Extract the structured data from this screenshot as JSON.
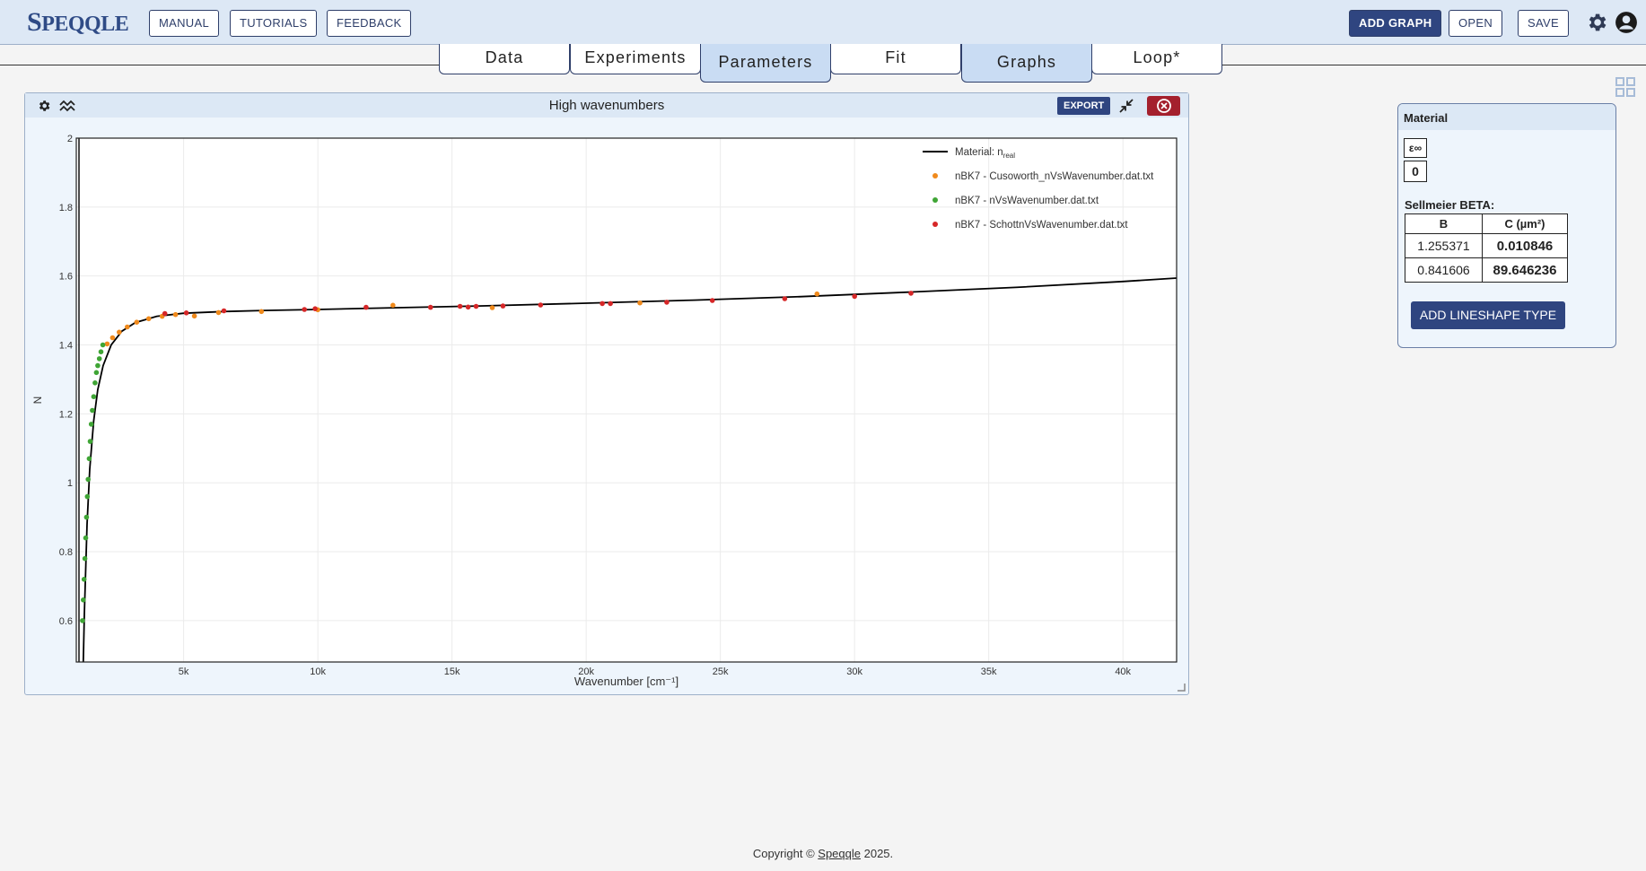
{
  "app": {
    "logo": "Speqqle",
    "logo_first": "S",
    "logo_rest": "PEQQLE"
  },
  "topbar": {
    "manual": "MANUAL",
    "tutorials": "TUTORIALS",
    "feedback": "FEEDBACK",
    "add_graph": "ADD GRAPH",
    "open": "OPEN",
    "save": "SAVE"
  },
  "tabs": [
    {
      "label": "Data"
    },
    {
      "label": "Experiments"
    },
    {
      "label": "Parameters",
      "active": true
    },
    {
      "label": "Fit"
    },
    {
      "label": "Graphs",
      "active": true
    },
    {
      "label": "Loop*"
    }
  ],
  "graph": {
    "title": "High wavenumbers",
    "export_label": "EXPORT"
  },
  "chart_data": {
    "type": "scatter",
    "xlabel": "Wavenumber [cm⁻¹]",
    "ylabel": "N",
    "xlim": [
      1000,
      42000
    ],
    "ylim": [
      0.48,
      2.0
    ],
    "xticks": [
      5000,
      10000,
      15000,
      20000,
      25000,
      30000,
      35000,
      40000
    ],
    "xtick_labels": [
      "5k",
      "10k",
      "15k",
      "20k",
      "25k",
      "30k",
      "35k",
      "40k"
    ],
    "yticks": [
      0.6,
      0.8,
      1,
      1.2,
      1.4,
      1.6,
      1.8,
      2
    ],
    "ytick_labels": [
      "0.6",
      "0.8",
      "1",
      "1.2",
      "1.4",
      "1.6",
      "1.8",
      "2"
    ],
    "grid": true,
    "legend_position": "top-right",
    "series": [
      {
        "name": "Material: n",
        "name_sub": "real",
        "kind": "line",
        "color": "#000000",
        "x": [
          1260,
          1300,
          1400,
          1500,
          1650,
          1800,
          2000,
          2300,
          2700,
          3200,
          4000,
          5000,
          6500,
          8000,
          10000,
          13000,
          16000,
          20000,
          24000,
          28000,
          32000,
          36000,
          40000,
          42000
        ],
        "y": [
          0.48,
          0.62,
          0.88,
          1.04,
          1.18,
          1.27,
          1.34,
          1.4,
          1.44,
          1.465,
          1.483,
          1.492,
          1.497,
          1.5,
          1.503,
          1.508,
          1.513,
          1.521,
          1.53,
          1.54,
          1.553,
          1.567,
          1.584,
          1.594
        ]
      },
      {
        "name": "nBK7 - Cusoworth_nVsWavenumber.dat.txt",
        "kind": "markers",
        "color": "#f08a1c",
        "x": [
          2150,
          2350,
          2600,
          2900,
          3250,
          3700,
          4200,
          4700,
          5400,
          6300,
          7900,
          10000,
          12800,
          16500,
          22000,
          28600
        ],
        "y": [
          1.403,
          1.421,
          1.437,
          1.452,
          1.466,
          1.476,
          1.483,
          1.488,
          1.484,
          1.494,
          1.497,
          1.502,
          1.515,
          1.508,
          1.522,
          1.548
        ]
      },
      {
        "name": "nBK7 - nVsWavenumber.dat.txt",
        "kind": "markers",
        "color": "#3fa535",
        "x": [
          1230,
          1260,
          1290,
          1320,
          1350,
          1380,
          1410,
          1440,
          1480,
          1520,
          1560,
          1600,
          1650,
          1700,
          1750,
          1800,
          1860,
          1920,
          1990
        ],
        "y": [
          0.6,
          0.66,
          0.72,
          0.78,
          0.84,
          0.9,
          0.96,
          1.01,
          1.07,
          1.12,
          1.17,
          1.21,
          1.25,
          1.29,
          1.32,
          1.34,
          1.36,
          1.38,
          1.4
        ]
      },
      {
        "name": "nBK7 - SchottnVsWavenumber.dat.txt",
        "kind": "markers",
        "color": "#d62728",
        "x": [
          4300,
          5100,
          6500,
          9500,
          9900,
          11800,
          14200,
          15300,
          15600,
          15900,
          16900,
          18300,
          20600,
          20900,
          23000,
          24700,
          27400,
          30000,
          32100
        ],
        "y": [
          1.491,
          1.493,
          1.499,
          1.503,
          1.505,
          1.509,
          1.509,
          1.512,
          1.51,
          1.512,
          1.513,
          1.516,
          1.52,
          1.52,
          1.524,
          1.529,
          1.534,
          1.541,
          1.55
        ]
      }
    ]
  },
  "material": {
    "title": "Material",
    "eps_label": "ε∞",
    "eps_value": "0",
    "sellmeier_label": "Sellmeier BETA:",
    "col_b": "B",
    "col_c": "C (µm²)",
    "rows": [
      {
        "b": "1.255371",
        "c": "0.010846"
      },
      {
        "b": "0.841606",
        "c": "89.646236"
      }
    ],
    "add_button": "ADD LINESHAPE TYPE"
  },
  "footer": {
    "prefix": "Copyright © ",
    "link": "Speqqle",
    "suffix": " 2025."
  }
}
